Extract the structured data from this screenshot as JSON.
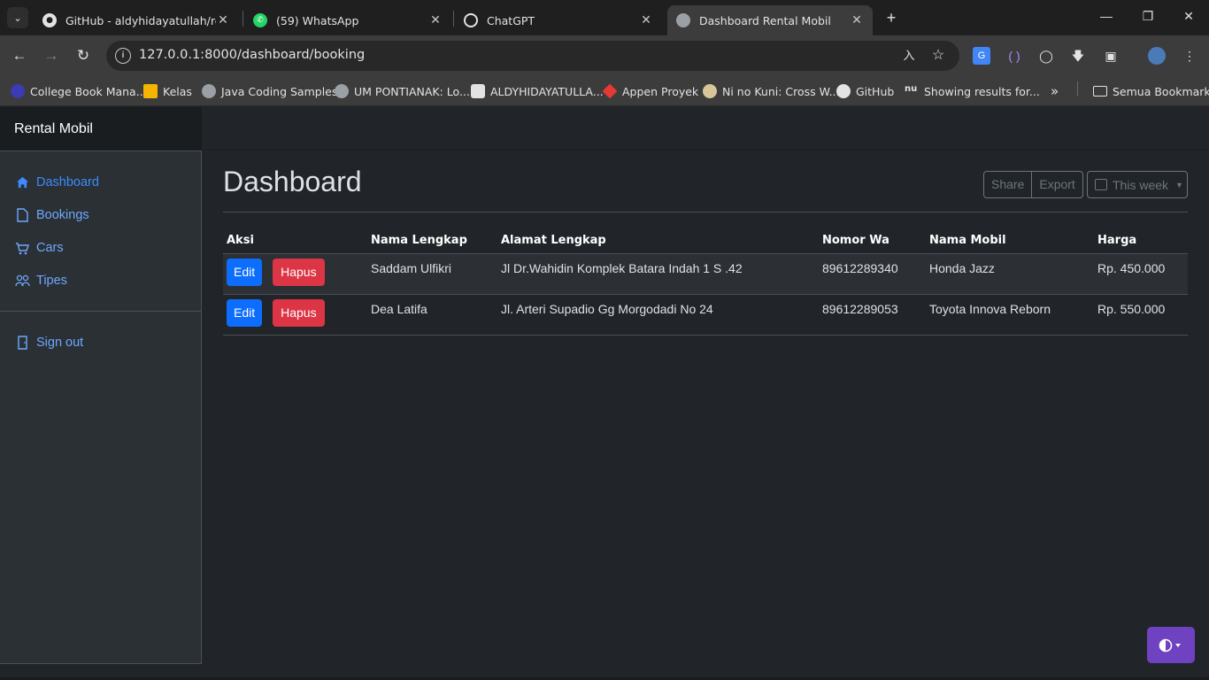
{
  "browser": {
    "tabs": [
      {
        "title": "GitHub - aldyhidayatullah/rental",
        "favicon": "github-icon"
      },
      {
        "title": "(59) WhatsApp",
        "favicon": "whatsapp-icon"
      },
      {
        "title": "ChatGPT",
        "favicon": "chatgpt-icon"
      },
      {
        "title": "Dashboard Rental Mobil",
        "favicon": "globe-icon",
        "active": true
      }
    ],
    "url": "127.0.0.1:8000/dashboard/booking",
    "bookmarks": [
      {
        "label": "College Book Mana..."
      },
      {
        "label": "Kelas"
      },
      {
        "label": "Java Coding Samples"
      },
      {
        "label": "UM PONTIANAK: Lo..."
      },
      {
        "label": "ALDYHIDAYATULLA..."
      },
      {
        "label": "Appen Proyek"
      },
      {
        "label": "Ni no Kuni: Cross W..."
      },
      {
        "label": "GitHub"
      },
      {
        "label": "Showing results for..."
      }
    ],
    "all_bookmarks": "Semua Bookmark"
  },
  "app": {
    "brand": "Rental Mobil",
    "sidebar": {
      "items": [
        {
          "label": "Dashboard",
          "icon": "house-icon",
          "active": true
        },
        {
          "label": "Bookings",
          "icon": "file-icon"
        },
        {
          "label": "Cars",
          "icon": "cart-icon"
        },
        {
          "label": "Tipes",
          "icon": "people-icon"
        }
      ],
      "signout": "Sign out"
    },
    "title": "Dashboard",
    "share": "Share",
    "export": "Export",
    "period": "This week"
  },
  "table": {
    "headers": [
      "Aksi",
      "Nama Lengkap",
      "Alamat Lengkap",
      "Nomor Wa",
      "Nama Mobil",
      "Harga"
    ],
    "edit_label": "Edit",
    "delete_label": "Hapus",
    "rows": [
      {
        "nama": "Saddam Ulfikri",
        "alamat": "Jl Dr.Wahidin Komplek Batara Indah 1 S .42",
        "wa": "89612289340",
        "mobil": "Honda Jazz",
        "harga": "Rp. 450.000"
      },
      {
        "nama": "Dea Latifa",
        "alamat": "Jl. Arteri Supadio Gg Morgodadi No 24",
        "wa": "89612289053",
        "mobil": "Toyota Innova Reborn",
        "harga": "Rp. 550.000"
      }
    ]
  },
  "colors": {
    "primary": "#0d6efd",
    "danger": "#dc3545",
    "theme_toggle": "#6f42c1"
  }
}
